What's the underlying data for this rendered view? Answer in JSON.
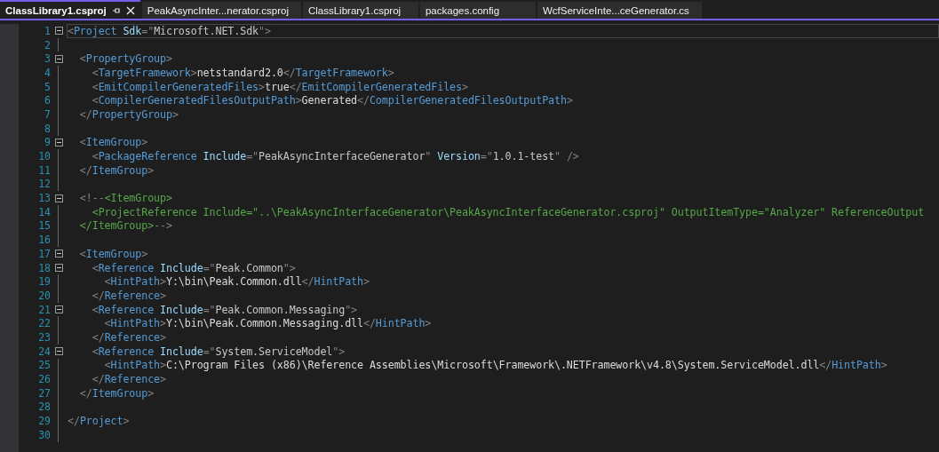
{
  "tabs": [
    {
      "label": "ClassLibrary1.csproj",
      "selected": true
    },
    {
      "label": "PeakAsyncInter...nerator.csproj",
      "selected": false
    },
    {
      "label": "ClassLibrary1.csproj",
      "selected": false
    },
    {
      "label": "packages.config",
      "selected": false
    },
    {
      "label": "WcfServiceInte...ceGenerator.cs",
      "selected": false
    }
  ],
  "editor": {
    "lines": [
      {
        "number": "1",
        "fold": true,
        "current": true,
        "tokens": [
          {
            "kind": "punct",
            "text": "<"
          },
          {
            "kind": "tag",
            "text": "Project"
          },
          {
            "kind": "attr",
            "text": " Sdk"
          },
          {
            "kind": "punct",
            "text": "=\""
          },
          {
            "kind": "value",
            "text": "Microsoft.NET.Sdk"
          },
          {
            "kind": "punct",
            "text": "\">"
          }
        ]
      },
      {
        "number": "2",
        "fold": false,
        "current": false
      },
      {
        "number": "3",
        "fold": true,
        "current": false,
        "tokens": [
          {
            "kind": "punct",
            "text": "  <"
          },
          {
            "kind": "tag",
            "text": "PropertyGroup"
          },
          {
            "kind": "punct",
            "text": ">"
          }
        ]
      },
      {
        "number": "4",
        "fold": false,
        "current": false,
        "tokens": [
          {
            "kind": "punct",
            "text": "    <"
          },
          {
            "kind": "tag",
            "text": "TargetFramework"
          },
          {
            "kind": "punct",
            "text": ">"
          },
          {
            "kind": "text",
            "text": "netstandard2.0"
          },
          {
            "kind": "punct",
            "text": "</"
          },
          {
            "kind": "tag",
            "text": "TargetFramework"
          },
          {
            "kind": "punct",
            "text": ">"
          }
        ]
      },
      {
        "number": "5",
        "fold": false,
        "current": false,
        "tokens": [
          {
            "kind": "punct",
            "text": "    <"
          },
          {
            "kind": "tag",
            "text": "EmitCompilerGeneratedFiles"
          },
          {
            "kind": "punct",
            "text": ">"
          },
          {
            "kind": "text",
            "text": "true"
          },
          {
            "kind": "punct",
            "text": "</"
          },
          {
            "kind": "tag",
            "text": "EmitCompilerGeneratedFiles"
          },
          {
            "kind": "punct",
            "text": ">"
          }
        ]
      },
      {
        "number": "6",
        "fold": false,
        "current": false,
        "tokens": [
          {
            "kind": "punct",
            "text": "    <"
          },
          {
            "kind": "tag",
            "text": "CompilerGeneratedFilesOutputPath"
          },
          {
            "kind": "punct",
            "text": ">"
          },
          {
            "kind": "text",
            "text": "Generated"
          },
          {
            "kind": "punct",
            "text": "</"
          },
          {
            "kind": "tag",
            "text": "CompilerGeneratedFilesOutputPath"
          },
          {
            "kind": "punct",
            "text": ">"
          }
        ]
      },
      {
        "number": "7",
        "fold": false,
        "current": false,
        "tokens": [
          {
            "kind": "punct",
            "text": "  </"
          },
          {
            "kind": "tag",
            "text": "PropertyGroup"
          },
          {
            "kind": "punct",
            "text": ">"
          }
        ]
      },
      {
        "number": "8",
        "fold": false,
        "current": false
      },
      {
        "number": "9",
        "fold": true,
        "current": false,
        "tokens": [
          {
            "kind": "punct",
            "text": "  <"
          },
          {
            "kind": "tag",
            "text": "ItemGroup"
          },
          {
            "kind": "punct",
            "text": ">"
          }
        ]
      },
      {
        "number": "10",
        "fold": false,
        "current": false,
        "tokens": [
          {
            "kind": "punct",
            "text": "    <"
          },
          {
            "kind": "tag",
            "text": "PackageReference"
          },
          {
            "kind": "attr",
            "text": " Include"
          },
          {
            "kind": "punct",
            "text": "=\""
          },
          {
            "kind": "value",
            "text": "PeakAsyncInterfaceGenerator"
          },
          {
            "kind": "punct",
            "text": "\" "
          },
          {
            "kind": "attr",
            "text": "Version"
          },
          {
            "kind": "punct",
            "text": "=\""
          },
          {
            "kind": "value",
            "text": "1.0.1-test"
          },
          {
            "kind": "punct",
            "text": "\" />"
          }
        ]
      },
      {
        "number": "11",
        "fold": false,
        "current": false,
        "tokens": [
          {
            "kind": "punct",
            "text": "  </"
          },
          {
            "kind": "tag",
            "text": "ItemGroup"
          },
          {
            "kind": "punct",
            "text": ">"
          }
        ]
      },
      {
        "number": "12",
        "fold": false,
        "current": false
      },
      {
        "number": "13",
        "fold": true,
        "current": false,
        "tokens": [
          {
            "kind": "punct",
            "text": "  <!--"
          },
          {
            "kind": "comment",
            "text": "<ItemGroup>"
          }
        ]
      },
      {
        "number": "14",
        "fold": false,
        "current": false,
        "tokens": [
          {
            "kind": "comment",
            "text": "    <ProjectReference Include=\"..\\PeakAsyncInterfaceGenerator\\PeakAsyncInterfaceGenerator.csproj\" OutputItemType=\"Analyzer\" ReferenceOutput"
          }
        ]
      },
      {
        "number": "15",
        "fold": false,
        "current": false,
        "tokens": [
          {
            "kind": "comment",
            "text": "  </ItemGroup>"
          },
          {
            "kind": "punct",
            "text": "-->"
          }
        ]
      },
      {
        "number": "16",
        "fold": false,
        "current": false
      },
      {
        "number": "17",
        "fold": true,
        "current": false,
        "tokens": [
          {
            "kind": "punct",
            "text": "  <"
          },
          {
            "kind": "tag",
            "text": "ItemGroup"
          },
          {
            "kind": "punct",
            "text": ">"
          }
        ]
      },
      {
        "number": "18",
        "fold": true,
        "current": false,
        "tokens": [
          {
            "kind": "punct",
            "text": "    <"
          },
          {
            "kind": "tag",
            "text": "Reference"
          },
          {
            "kind": "attr",
            "text": " Include"
          },
          {
            "kind": "punct",
            "text": "=\""
          },
          {
            "kind": "value",
            "text": "Peak.Common"
          },
          {
            "kind": "punct",
            "text": "\">"
          }
        ]
      },
      {
        "number": "19",
        "fold": false,
        "current": false,
        "tokens": [
          {
            "kind": "punct",
            "text": "      <"
          },
          {
            "kind": "tag",
            "text": "HintPath"
          },
          {
            "kind": "punct",
            "text": ">"
          },
          {
            "kind": "text",
            "text": "Y:\\bin\\Peak.Common.dll"
          },
          {
            "kind": "punct",
            "text": "</"
          },
          {
            "kind": "tag",
            "text": "HintPath"
          },
          {
            "kind": "punct",
            "text": ">"
          }
        ]
      },
      {
        "number": "20",
        "fold": false,
        "current": false,
        "tokens": [
          {
            "kind": "punct",
            "text": "    </"
          },
          {
            "kind": "tag",
            "text": "Reference"
          },
          {
            "kind": "punct",
            "text": ">"
          }
        ]
      },
      {
        "number": "21",
        "fold": true,
        "current": false,
        "tokens": [
          {
            "kind": "punct",
            "text": "    <"
          },
          {
            "kind": "tag",
            "text": "Reference"
          },
          {
            "kind": "attr",
            "text": " Include"
          },
          {
            "kind": "punct",
            "text": "=\""
          },
          {
            "kind": "value",
            "text": "Peak.Common.Messaging"
          },
          {
            "kind": "punct",
            "text": "\">"
          }
        ]
      },
      {
        "number": "22",
        "fold": false,
        "current": false,
        "tokens": [
          {
            "kind": "punct",
            "text": "      <"
          },
          {
            "kind": "tag",
            "text": "HintPath"
          },
          {
            "kind": "punct",
            "text": ">"
          },
          {
            "kind": "text",
            "text": "Y:\\bin\\Peak.Common.Messaging.dll"
          },
          {
            "kind": "punct",
            "text": "</"
          },
          {
            "kind": "tag",
            "text": "HintPath"
          },
          {
            "kind": "punct",
            "text": ">"
          }
        ]
      },
      {
        "number": "23",
        "fold": false,
        "current": false,
        "tokens": [
          {
            "kind": "punct",
            "text": "    </"
          },
          {
            "kind": "tag",
            "text": "Reference"
          },
          {
            "kind": "punct",
            "text": ">"
          }
        ]
      },
      {
        "number": "24",
        "fold": true,
        "current": false,
        "tokens": [
          {
            "kind": "punct",
            "text": "    <"
          },
          {
            "kind": "tag",
            "text": "Reference"
          },
          {
            "kind": "attr",
            "text": " Include"
          },
          {
            "kind": "punct",
            "text": "=\""
          },
          {
            "kind": "value",
            "text": "System.ServiceModel"
          },
          {
            "kind": "punct",
            "text": "\">"
          }
        ]
      },
      {
        "number": "25",
        "fold": false,
        "current": false,
        "tokens": [
          {
            "kind": "punct",
            "text": "      <"
          },
          {
            "kind": "tag",
            "text": "HintPath"
          },
          {
            "kind": "punct",
            "text": ">"
          },
          {
            "kind": "text",
            "text": "C:\\Program Files (x86)\\Reference Assemblies\\Microsoft\\Framework\\.NETFramework\\v4.8\\System.ServiceModel.dll"
          },
          {
            "kind": "punct",
            "text": "</"
          },
          {
            "kind": "tag",
            "text": "HintPath"
          },
          {
            "kind": "punct",
            "text": ">"
          }
        ]
      },
      {
        "number": "26",
        "fold": false,
        "current": false,
        "tokens": [
          {
            "kind": "punct",
            "text": "    </"
          },
          {
            "kind": "tag",
            "text": "Reference"
          },
          {
            "kind": "punct",
            "text": ">"
          }
        ]
      },
      {
        "number": "27",
        "fold": false,
        "current": false,
        "tokens": [
          {
            "kind": "punct",
            "text": "  </"
          },
          {
            "kind": "tag",
            "text": "ItemGroup"
          },
          {
            "kind": "punct",
            "text": ">"
          }
        ]
      },
      {
        "number": "28",
        "fold": false,
        "current": false
      },
      {
        "number": "29",
        "fold": false,
        "current": false,
        "tokens": [
          {
            "kind": "punct",
            "text": "</"
          },
          {
            "kind": "tag",
            "text": "Project"
          },
          {
            "kind": "punct",
            "text": ">"
          }
        ]
      },
      {
        "number": "30",
        "fold": false,
        "current": false
      }
    ]
  }
}
